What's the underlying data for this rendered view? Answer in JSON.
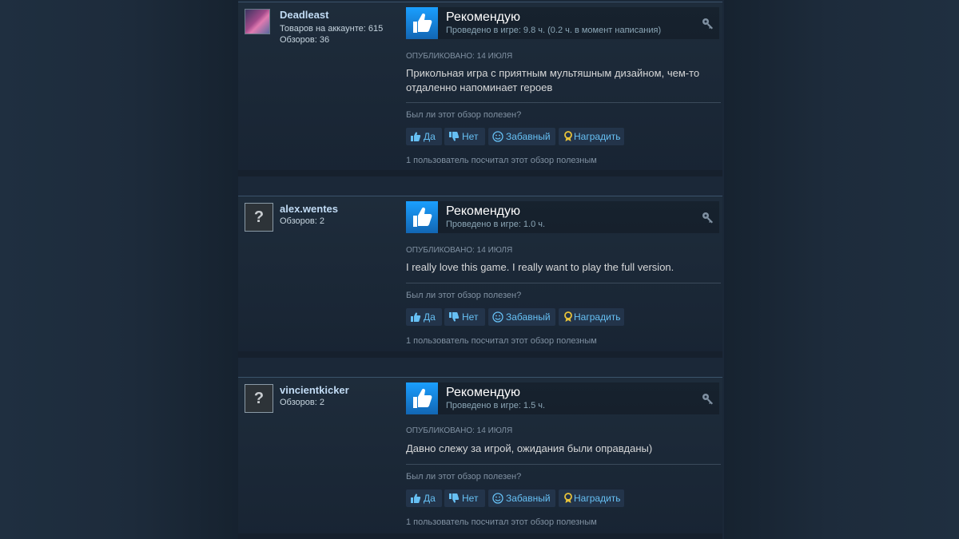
{
  "reviews": [
    {
      "author": "Deadleast",
      "stats": [
        "Товаров на аккаунте: 615",
        "Обзоров: 36"
      ],
      "avatar": "custom-avatar",
      "recommendation": "Рекомендую",
      "played": "Проведено в игре: 9.8 ч. (0.2 ч. в момент написания)",
      "posted": "ОПУБЛИКОВАНО: 14 ИЮЛЯ",
      "text": "Прикольная игра с приятным мультяшным дизайном, чем-то отдаленно напоминает героев",
      "helpful_question": "Был ли этот обзор полезен?",
      "buttons": {
        "yes": "Да",
        "no": "Нет",
        "funny": "Забавный",
        "award": "Наградить"
      },
      "helpful_count": "1 пользователь посчитал этот обзор полезным"
    },
    {
      "author": "alex.wentes",
      "stats": [
        "Обзоров: 2"
      ],
      "avatar": "default-avatar",
      "avatar_glyph": "?",
      "recommendation": "Рекомендую",
      "played": "Проведено в игре: 1.0 ч.",
      "posted": "ОПУБЛИКОВАНО: 14 ИЮЛЯ",
      "text": "I really love this game. I really want to play the full version.",
      "helpful_question": "Был ли этот обзор полезен?",
      "buttons": {
        "yes": "Да",
        "no": "Нет",
        "funny": "Забавный",
        "award": "Наградить"
      },
      "helpful_count": "1 пользователь посчитал этот обзор полезным"
    },
    {
      "author": "vincientkicker",
      "stats": [
        "Обзоров: 2"
      ],
      "avatar": "default-avatar",
      "avatar_glyph": "?",
      "recommendation": "Рекомендую",
      "played": "Проведено в игре: 1.5 ч.",
      "posted": "ОПУБЛИКОВАНО: 14 ИЮЛЯ",
      "text": "Давно слежу за игрой, ожидания были оправданы)",
      "helpful_question": "Был ли этот обзор полезен?",
      "buttons": {
        "yes": "Да",
        "no": "Нет",
        "funny": "Забавный",
        "award": "Наградить"
      },
      "helpful_count": "1 пользователь посчитал этот обзор полезным"
    }
  ],
  "colors": {
    "page_bg": "#1b2838",
    "link_blue": "#66c0f4",
    "author_name": "#c1dbf4",
    "thumb_blue": "#1a9fff",
    "muted_text": "#8091a2",
    "award_gold": "#e8c33a"
  },
  "icons": {
    "thumb": "thumbs-up-icon",
    "developer_response": "key-icon",
    "yes": "thumbs-up-small-icon",
    "no": "thumbs-down-small-icon",
    "funny": "smiley-icon",
    "award": "award-ribbon-icon"
  }
}
